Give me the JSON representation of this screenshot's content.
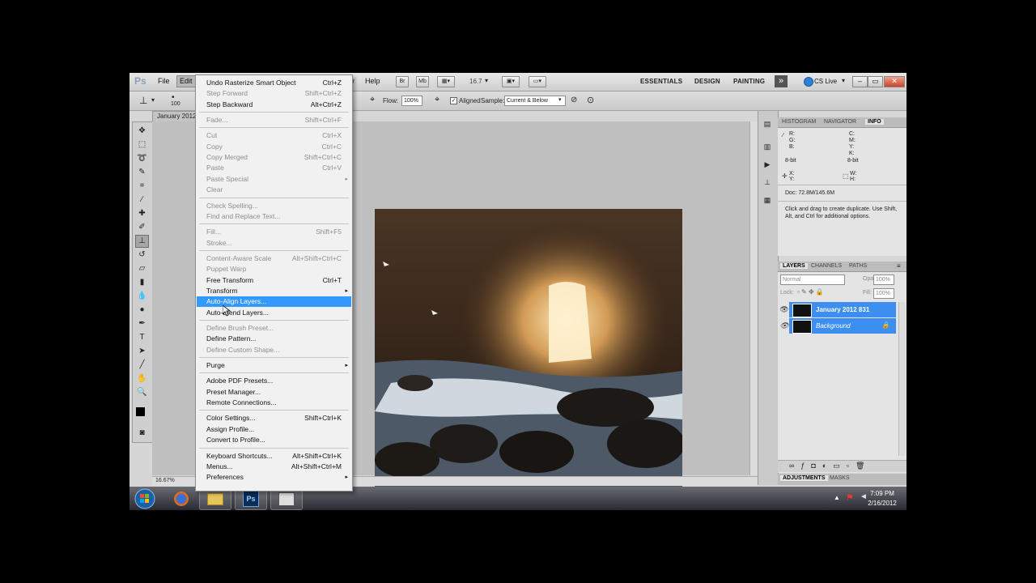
{
  "app": {
    "logo": "Ps",
    "menus": [
      "File",
      "Edit",
      "",
      "Help"
    ],
    "bridge": "Br",
    "minibridge": "Mb",
    "zoom": "16.7",
    "workspaces": [
      "ESSENTIALS",
      "DESIGN",
      "PAINTING"
    ],
    "more": "»",
    "cslive": "CS Live"
  },
  "options": {
    "brush_size": "100",
    "flow_label": "Flow:",
    "flow_value": "100%",
    "aligned_label": "Aligned",
    "sample_label": "Sample:",
    "sample_value": "Current & Below"
  },
  "document": {
    "tab": "January 2012",
    "zoom_status": "16.67%"
  },
  "edit_menu": [
    {
      "label": "Undo Rasterize Smart Object",
      "shortcut": "Ctrl+Z",
      "disabled": false
    },
    {
      "label": "Step Forward",
      "shortcut": "Shift+Ctrl+Z",
      "disabled": true
    },
    {
      "label": "Step Backward",
      "shortcut": "Alt+Ctrl+Z",
      "disabled": false
    },
    {
      "sep": true
    },
    {
      "label": "Fade...",
      "shortcut": "Shift+Ctrl+F",
      "disabled": true
    },
    {
      "sep": true
    },
    {
      "label": "Cut",
      "shortcut": "Ctrl+X",
      "disabled": true
    },
    {
      "label": "Copy",
      "shortcut": "Ctrl+C",
      "disabled": true
    },
    {
      "label": "Copy Merged",
      "shortcut": "Shift+Ctrl+C",
      "disabled": true
    },
    {
      "label": "Paste",
      "shortcut": "Ctrl+V",
      "disabled": true
    },
    {
      "label": "Paste Special",
      "shortcut": "",
      "disabled": true,
      "submenu": true
    },
    {
      "label": "Clear",
      "shortcut": "",
      "disabled": true
    },
    {
      "sep": true
    },
    {
      "label": "Check Spelling...",
      "shortcut": "",
      "disabled": true
    },
    {
      "label": "Find and Replace Text...",
      "shortcut": "",
      "disabled": true
    },
    {
      "sep": true
    },
    {
      "label": "Fill...",
      "shortcut": "Shift+F5",
      "disabled": true
    },
    {
      "label": "Stroke...",
      "shortcut": "",
      "disabled": true
    },
    {
      "sep": true
    },
    {
      "label": "Content-Aware Scale",
      "shortcut": "Alt+Shift+Ctrl+C",
      "disabled": true
    },
    {
      "label": "Puppet Warp",
      "shortcut": "",
      "disabled": true
    },
    {
      "label": "Free Transform",
      "shortcut": "Ctrl+T",
      "disabled": false
    },
    {
      "label": "Transform",
      "shortcut": "",
      "disabled": false,
      "submenu": true
    },
    {
      "label": "Auto-Align Layers...",
      "shortcut": "",
      "disabled": false,
      "highlight": true
    },
    {
      "label": "Auto-Blend Layers...",
      "shortcut": "",
      "disabled": false
    },
    {
      "sep": true
    },
    {
      "label": "Define Brush Preset...",
      "shortcut": "",
      "disabled": true
    },
    {
      "label": "Define Pattern...",
      "shortcut": "",
      "disabled": false
    },
    {
      "label": "Define Custom Shape...",
      "shortcut": "",
      "disabled": true
    },
    {
      "sep": true
    },
    {
      "label": "Purge",
      "shortcut": "",
      "disabled": false,
      "submenu": true
    },
    {
      "sep": true
    },
    {
      "label": "Adobe PDF Presets...",
      "shortcut": "",
      "disabled": false
    },
    {
      "label": "Preset Manager...",
      "shortcut": "",
      "disabled": false
    },
    {
      "label": "Remote Connections...",
      "shortcut": "",
      "disabled": false
    },
    {
      "sep": true
    },
    {
      "label": "Color Settings...",
      "shortcut": "Shift+Ctrl+K",
      "disabled": false
    },
    {
      "label": "Assign Profile...",
      "shortcut": "",
      "disabled": false
    },
    {
      "label": "Convert to Profile...",
      "shortcut": "",
      "disabled": false
    },
    {
      "sep": true
    },
    {
      "label": "Keyboard Shortcuts...",
      "shortcut": "Alt+Shift+Ctrl+K",
      "disabled": false
    },
    {
      "label": "Menus...",
      "shortcut": "Alt+Shift+Ctrl+M",
      "disabled": false
    },
    {
      "label": "Preferences",
      "shortcut": "",
      "disabled": false,
      "submenu": true
    }
  ],
  "info_panel": {
    "tabs": [
      "HISTOGRAM",
      "NAVIGATOR",
      "INFO"
    ],
    "rgb": "R:\nG:\nB:",
    "cmyk": "C:\nM:\nY:\nK:",
    "bit_left": "8-bit",
    "bit_right": "8-bit",
    "xy": "X:\nY:",
    "wh": "W:\nH:",
    "doc": "Doc: 72.8M/145.6M",
    "hint": "Click and drag to create duplicate.  Use Shift, Alt, and Ctrl for additional options."
  },
  "layers_panel": {
    "tabs": [
      "LAYERS",
      "CHANNELS",
      "PATHS"
    ],
    "blend_mode": "Normal",
    "opacity_label": "Opacity:",
    "opacity_value": "100%",
    "lock_label": "Lock:",
    "fill_label": "Fill:",
    "fill_value": "100%",
    "layers": [
      {
        "name": "January 2012 831"
      },
      {
        "name": "Background"
      }
    ]
  },
  "adjust_panel": {
    "tabs": [
      "ADJUSTMENTS",
      "MASKS"
    ]
  },
  "taskbar": {
    "photoshop": "Ps",
    "time": "7:09 PM",
    "date": "2/16/2012"
  }
}
